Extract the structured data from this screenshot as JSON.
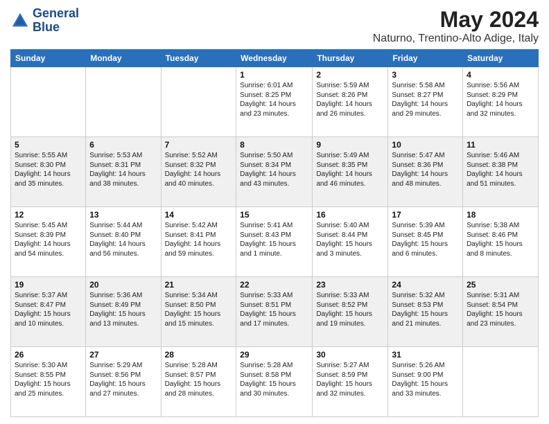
{
  "header": {
    "logo_line1": "General",
    "logo_line2": "Blue",
    "month": "May 2024",
    "location": "Naturno, Trentino-Alto Adige, Italy"
  },
  "weekdays": [
    "Sunday",
    "Monday",
    "Tuesday",
    "Wednesday",
    "Thursday",
    "Friday",
    "Saturday"
  ],
  "weeks": [
    [
      {
        "day": "",
        "info": ""
      },
      {
        "day": "",
        "info": ""
      },
      {
        "day": "",
        "info": ""
      },
      {
        "day": "1",
        "info": "Sunrise: 6:01 AM\nSunset: 8:25 PM\nDaylight: 14 hours\nand 23 minutes."
      },
      {
        "day": "2",
        "info": "Sunrise: 5:59 AM\nSunset: 8:26 PM\nDaylight: 14 hours\nand 26 minutes."
      },
      {
        "day": "3",
        "info": "Sunrise: 5:58 AM\nSunset: 8:27 PM\nDaylight: 14 hours\nand 29 minutes."
      },
      {
        "day": "4",
        "info": "Sunrise: 5:56 AM\nSunset: 8:29 PM\nDaylight: 14 hours\nand 32 minutes."
      }
    ],
    [
      {
        "day": "5",
        "info": "Sunrise: 5:55 AM\nSunset: 8:30 PM\nDaylight: 14 hours\nand 35 minutes."
      },
      {
        "day": "6",
        "info": "Sunrise: 5:53 AM\nSunset: 8:31 PM\nDaylight: 14 hours\nand 38 minutes."
      },
      {
        "day": "7",
        "info": "Sunrise: 5:52 AM\nSunset: 8:32 PM\nDaylight: 14 hours\nand 40 minutes."
      },
      {
        "day": "8",
        "info": "Sunrise: 5:50 AM\nSunset: 8:34 PM\nDaylight: 14 hours\nand 43 minutes."
      },
      {
        "day": "9",
        "info": "Sunrise: 5:49 AM\nSunset: 8:35 PM\nDaylight: 14 hours\nand 46 minutes."
      },
      {
        "day": "10",
        "info": "Sunrise: 5:47 AM\nSunset: 8:36 PM\nDaylight: 14 hours\nand 48 minutes."
      },
      {
        "day": "11",
        "info": "Sunrise: 5:46 AM\nSunset: 8:38 PM\nDaylight: 14 hours\nand 51 minutes."
      }
    ],
    [
      {
        "day": "12",
        "info": "Sunrise: 5:45 AM\nSunset: 8:39 PM\nDaylight: 14 hours\nand 54 minutes."
      },
      {
        "day": "13",
        "info": "Sunrise: 5:44 AM\nSunset: 8:40 PM\nDaylight: 14 hours\nand 56 minutes."
      },
      {
        "day": "14",
        "info": "Sunrise: 5:42 AM\nSunset: 8:41 PM\nDaylight: 14 hours\nand 59 minutes."
      },
      {
        "day": "15",
        "info": "Sunrise: 5:41 AM\nSunset: 8:43 PM\nDaylight: 15 hours\nand 1 minute."
      },
      {
        "day": "16",
        "info": "Sunrise: 5:40 AM\nSunset: 8:44 PM\nDaylight: 15 hours\nand 3 minutes."
      },
      {
        "day": "17",
        "info": "Sunrise: 5:39 AM\nSunset: 8:45 PM\nDaylight: 15 hours\nand 6 minutes."
      },
      {
        "day": "18",
        "info": "Sunrise: 5:38 AM\nSunset: 8:46 PM\nDaylight: 15 hours\nand 8 minutes."
      }
    ],
    [
      {
        "day": "19",
        "info": "Sunrise: 5:37 AM\nSunset: 8:47 PM\nDaylight: 15 hours\nand 10 minutes."
      },
      {
        "day": "20",
        "info": "Sunrise: 5:36 AM\nSunset: 8:49 PM\nDaylight: 15 hours\nand 13 minutes."
      },
      {
        "day": "21",
        "info": "Sunrise: 5:34 AM\nSunset: 8:50 PM\nDaylight: 15 hours\nand 15 minutes."
      },
      {
        "day": "22",
        "info": "Sunrise: 5:33 AM\nSunset: 8:51 PM\nDaylight: 15 hours\nand 17 minutes."
      },
      {
        "day": "23",
        "info": "Sunrise: 5:33 AM\nSunset: 8:52 PM\nDaylight: 15 hours\nand 19 minutes."
      },
      {
        "day": "24",
        "info": "Sunrise: 5:32 AM\nSunset: 8:53 PM\nDaylight: 15 hours\nand 21 minutes."
      },
      {
        "day": "25",
        "info": "Sunrise: 5:31 AM\nSunset: 8:54 PM\nDaylight: 15 hours\nand 23 minutes."
      }
    ],
    [
      {
        "day": "26",
        "info": "Sunrise: 5:30 AM\nSunset: 8:55 PM\nDaylight: 15 hours\nand 25 minutes."
      },
      {
        "day": "27",
        "info": "Sunrise: 5:29 AM\nSunset: 8:56 PM\nDaylight: 15 hours\nand 27 minutes."
      },
      {
        "day": "28",
        "info": "Sunrise: 5:28 AM\nSunset: 8:57 PM\nDaylight: 15 hours\nand 28 minutes."
      },
      {
        "day": "29",
        "info": "Sunrise: 5:28 AM\nSunset: 8:58 PM\nDaylight: 15 hours\nand 30 minutes."
      },
      {
        "day": "30",
        "info": "Sunrise: 5:27 AM\nSunset: 8:59 PM\nDaylight: 15 hours\nand 32 minutes."
      },
      {
        "day": "31",
        "info": "Sunrise: 5:26 AM\nSunset: 9:00 PM\nDaylight: 15 hours\nand 33 minutes."
      },
      {
        "day": "",
        "info": ""
      }
    ]
  ]
}
